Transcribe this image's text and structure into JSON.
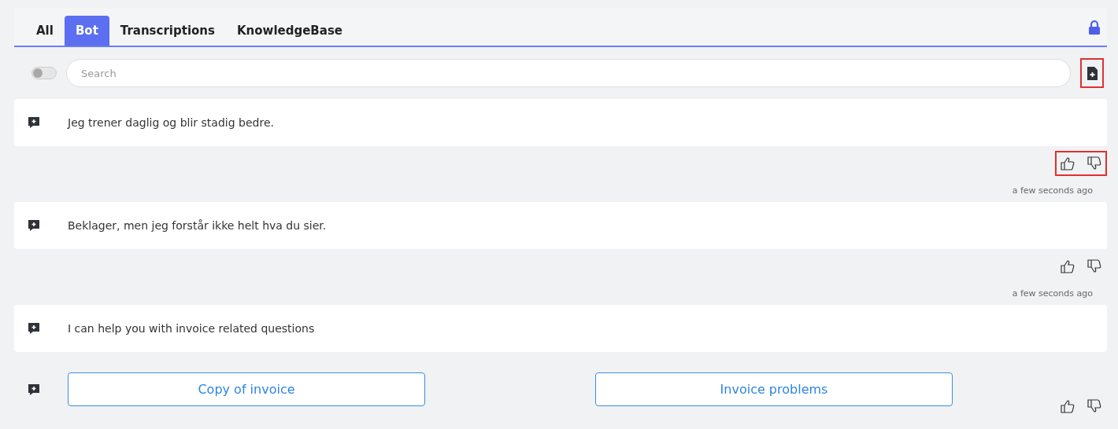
{
  "tabs": [
    {
      "label": "All",
      "selected": false
    },
    {
      "label": "Bot",
      "selected": true
    },
    {
      "label": "Transcriptions",
      "selected": false
    },
    {
      "label": "KnowledgeBase",
      "selected": false
    }
  ],
  "locked": true,
  "toolbar": {
    "toggle_on": false,
    "search": {
      "placeholder": "Search"
    },
    "add_document": {
      "highlighted": true
    }
  },
  "messages": [
    {
      "kind": "text",
      "text": "Jeg trener daglig og blir stadig bedre.",
      "feedback": {
        "highlighted": true
      },
      "time": "a few seconds ago"
    },
    {
      "kind": "text",
      "text": "Beklager, men jeg forstår ikke helt hva du sier.",
      "feedback": {
        "highlighted": false
      },
      "time": "a few seconds ago"
    },
    {
      "kind": "text",
      "text": "I can help you with invoice related questions"
    },
    {
      "kind": "options",
      "options": [
        "Copy of invoice",
        "Invoice problems"
      ],
      "feedback": {
        "highlighted": false
      }
    }
  ]
}
